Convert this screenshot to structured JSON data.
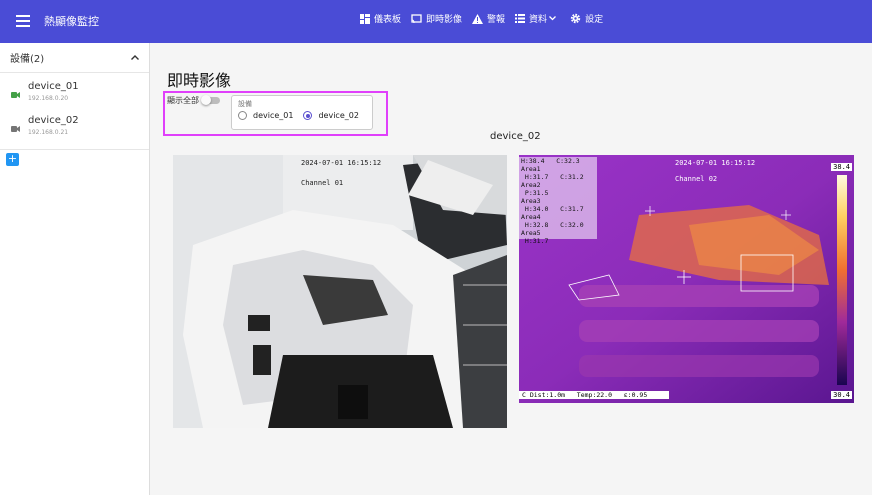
{
  "app": {
    "title": "熱顯像監控"
  },
  "nav": {
    "dashboard": "儀表板",
    "live": "即時影像",
    "alerts": "警報",
    "data": "資料",
    "settings": "設定"
  },
  "sidebar": {
    "header": "設備(2)",
    "devices": [
      {
        "name": "device_01",
        "ip": "192.168.0.20",
        "status_color": "#43a047"
      },
      {
        "name": "device_02",
        "ip": "192.168.0.21",
        "status_color": "#757575"
      }
    ],
    "add_label": "+"
  },
  "main": {
    "title": "即時影像",
    "show_all_label": "顯示全部",
    "show_all_on": false,
    "device_group_label": "設備",
    "radio_options": [
      "device_01",
      "device_02"
    ],
    "selected_device": "device_02",
    "device_heading": "device_02"
  },
  "rgb_feed": {
    "timestamp": "2024-07-01 16:15:12",
    "channel": "Channel 01"
  },
  "thermal_feed": {
    "timestamp": "2024-07-01 16:15:12",
    "channel": "Channel 02",
    "scale_max": "38.4",
    "scale_min": "30.4",
    "areas": [
      "H:38.4   C:32.3",
      "Area1",
      " H:31.7   C:31.2",
      "Area2",
      " P:31.5",
      "Area3",
      " H:34.0   C:31.7",
      "Area4",
      " H:32.8   C:32.0",
      "Area5",
      " H:31.7"
    ],
    "footer": "C Dist:1.0m   Temp:22.0   ε:0.95",
    "colors": {
      "hot": "#ffd060",
      "warm": "#f07030",
      "cool": "#8a2fc0",
      "cold": "#2a0a70"
    }
  },
  "colors": {
    "appbar": "#4a4cd6",
    "highlight": "#e040fb",
    "accent": "#5a4fcf",
    "add_button": "#2196f3"
  }
}
